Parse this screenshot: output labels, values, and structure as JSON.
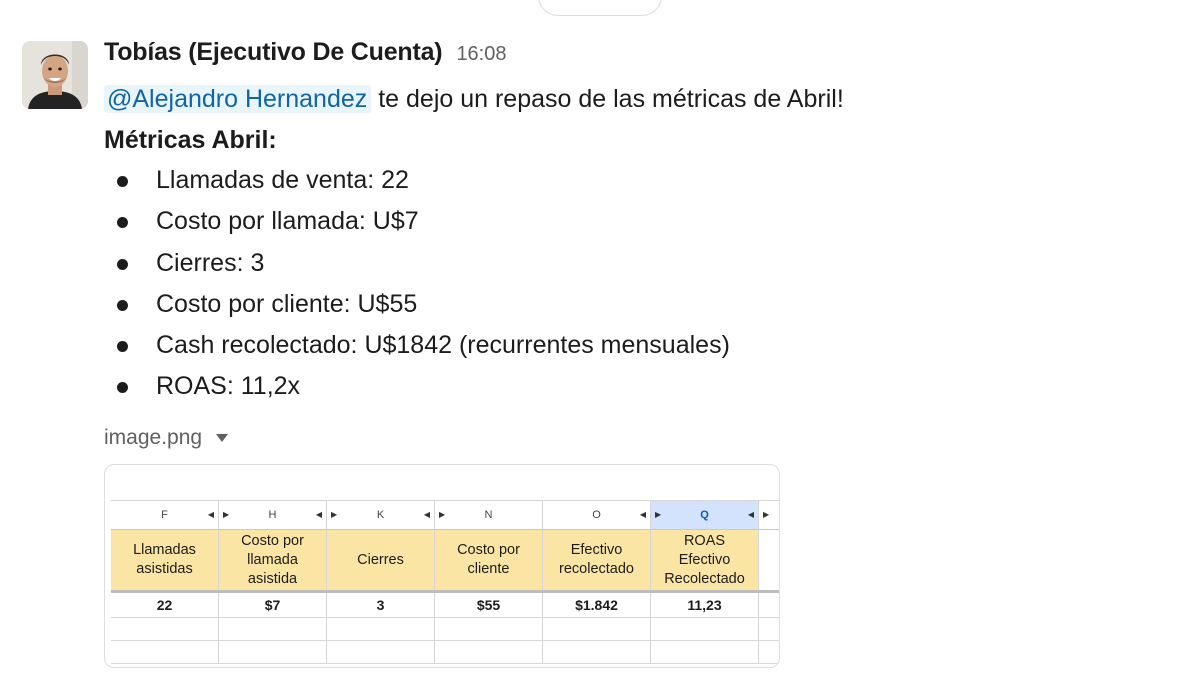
{
  "message": {
    "sender": "Tobías (Ejecutivo De Cuenta)",
    "time": "16:08",
    "mention": "@Alejandro Hernandez",
    "text": "te dejo un repaso de las métricas de Abril!",
    "metrics_title": "Métricas Abril:",
    "metrics": [
      "Llamadas de venta: 22",
      "Costo por llamada: U$7",
      "Cierres: 3",
      "Costo por cliente: U$55",
      "Cash recolectado: U$1842 (recurrentes mensuales)",
      "ROAS: 11,2x"
    ]
  },
  "attachment": {
    "filename": "image.png",
    "sheet": {
      "column_letters": [
        "F",
        "H",
        "K",
        "N",
        "O",
        "Q"
      ],
      "selected_column": "Q",
      "headers": [
        [
          "Llamadas",
          "asistidas"
        ],
        [
          "Costo por",
          "llamada",
          "asistida"
        ],
        [
          "Cierres"
        ],
        [
          "Costo por",
          "cliente"
        ],
        [
          "Efectivo",
          "recolectado"
        ],
        [
          "ROAS",
          "Efectivo",
          "Recolectado"
        ]
      ],
      "values": [
        "22",
        "$7",
        "3",
        "$55",
        "$1.842",
        "11,23"
      ]
    }
  },
  "colors": {
    "mention_bg": "#e8f5fa",
    "mention_text": "#1264a3",
    "header_fill": "#fbe5a5",
    "selected_column": "#d3e3fd"
  }
}
